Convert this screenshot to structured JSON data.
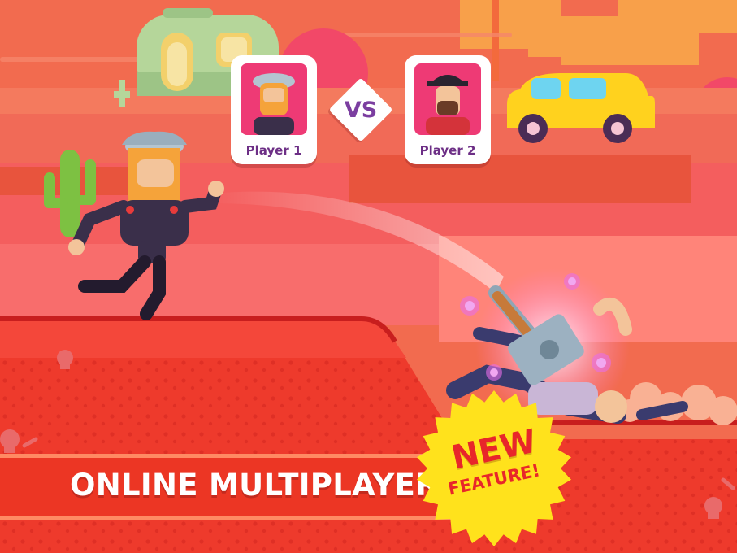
{
  "match": {
    "player1_name": "Player 1",
    "player2_name": "Player 2",
    "versus_label": "VS"
  },
  "banner": {
    "text": "ONLINE MULTIPLAYER!"
  },
  "badge": {
    "line1": "NEW",
    "line2": "FEATURE!",
    "color": "#ffe21c"
  },
  "colors": {
    "sky": "#f26b4f",
    "ground": "#ee3a2c",
    "banner": "#ec3624",
    "accent_purple": "#7b3ea0",
    "car": "#ffd21e"
  },
  "icons": [
    "caravan-icon",
    "car-icon",
    "cactus-icon",
    "skull-icon",
    "bone-icon",
    "hammer-icon"
  ]
}
